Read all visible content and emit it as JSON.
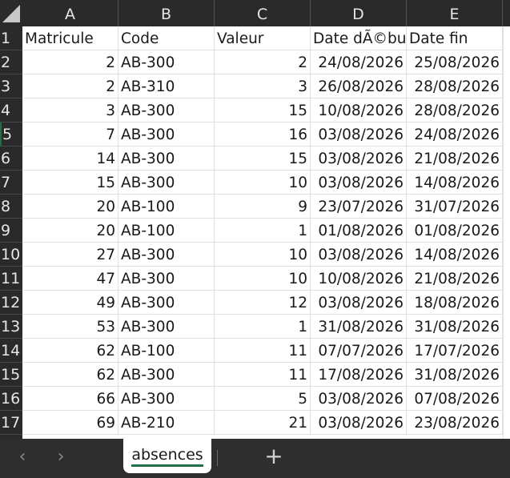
{
  "columns": [
    "A",
    "B",
    "C",
    "D",
    "E"
  ],
  "row_numbers": [
    "1",
    "2",
    "3",
    "4",
    "5",
    "6",
    "7",
    "8",
    "9",
    "10",
    "11",
    "12",
    "13",
    "14",
    "15",
    "16",
    "17"
  ],
  "header_row": [
    "Matricule",
    "Code",
    "Valeur",
    "Date dÃ©but",
    "Date fin"
  ],
  "rows": [
    [
      "2",
      "AB-300",
      "2",
      "24/08/2026",
      "25/08/2026"
    ],
    [
      "2",
      "AB-310",
      "3",
      "26/08/2026",
      "28/08/2026"
    ],
    [
      "3",
      "AB-300",
      "15",
      "10/08/2026",
      "28/08/2026"
    ],
    [
      "7",
      "AB-300",
      "16",
      "03/08/2026",
      "24/08/2026"
    ],
    [
      "14",
      "AB-300",
      "15",
      "03/08/2026",
      "21/08/2026"
    ],
    [
      "15",
      "AB-300",
      "10",
      "03/08/2026",
      "14/08/2026"
    ],
    [
      "20",
      "AB-100",
      "9",
      "23/07/2026",
      "31/07/2026"
    ],
    [
      "20",
      "AB-100",
      "1",
      "01/08/2026",
      "01/08/2026"
    ],
    [
      "27",
      "AB-300",
      "10",
      "03/08/2026",
      "14/08/2026"
    ],
    [
      "47",
      "AB-300",
      "10",
      "10/08/2026",
      "21/08/2026"
    ],
    [
      "49",
      "AB-300",
      "12",
      "03/08/2026",
      "18/08/2026"
    ],
    [
      "53",
      "AB-300",
      "1",
      "31/08/2026",
      "31/08/2026"
    ],
    [
      "62",
      "AB-100",
      "11",
      "07/07/2026",
      "17/07/2026"
    ],
    [
      "62",
      "AB-300",
      "11",
      "17/08/2026",
      "31/08/2026"
    ],
    [
      "66",
      "AB-300",
      "5",
      "03/08/2026",
      "07/08/2026"
    ],
    [
      "69",
      "AB-210",
      "21",
      "03/08/2026",
      "23/08/2026"
    ]
  ],
  "sheet_tab": {
    "label": "absences"
  },
  "tabbar": {
    "prev_icon": "‹",
    "next_icon": "›",
    "add_icon": "+"
  },
  "colors": {
    "accent": "#1e7145",
    "header_bg": "#2a2a2a",
    "gridline": "#e1e1e1"
  }
}
